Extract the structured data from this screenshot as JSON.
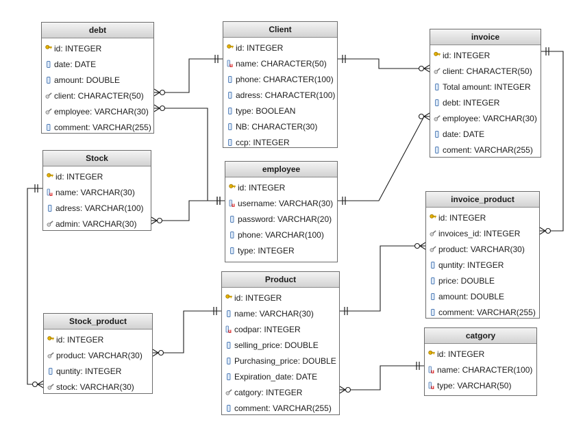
{
  "tables": [
    {
      "name": "debt",
      "fields": [
        {
          "text": "id: INTEGER",
          "icon": "key-icon"
        },
        {
          "text": "date: DATE",
          "icon": "column-icon"
        },
        {
          "text": "amount: DOUBLE",
          "icon": "column-icon"
        },
        {
          "text": "client: CHARACTER(50)",
          "icon": "foreign-key-icon"
        },
        {
          "text": "employee: VARCHAR(30)",
          "icon": "foreign-key-icon"
        },
        {
          "text": "comment: VARCHAR(255)",
          "icon": "column-icon"
        }
      ]
    },
    {
      "name": "Client",
      "fields": [
        {
          "text": "id: INTEGER",
          "icon": "key-icon"
        },
        {
          "text": "name: CHARACTER(50)",
          "icon": "unique-icon"
        },
        {
          "text": "phone: CHARACTER(100)",
          "icon": "column-icon"
        },
        {
          "text": "adress: CHARACTER(100)",
          "icon": "column-icon"
        },
        {
          "text": "type: BOOLEAN",
          "icon": "column-icon"
        },
        {
          "text": "NB: CHARACTER(30)",
          "icon": "column-icon"
        },
        {
          "text": "ccp: INTEGER",
          "icon": "column-icon"
        }
      ]
    },
    {
      "name": "invoice",
      "fields": [
        {
          "text": "id: INTEGER",
          "icon": "key-icon"
        },
        {
          "text": "client: CHARACTER(50)",
          "icon": "foreign-key-icon"
        },
        {
          "text": "Total amount: INTEGER",
          "icon": "column-icon"
        },
        {
          "text": "debt: INTEGER",
          "icon": "column-icon"
        },
        {
          "text": "employee: VARCHAR(30)",
          "icon": "foreign-key-icon"
        },
        {
          "text": "date: DATE",
          "icon": "column-icon"
        },
        {
          "text": "coment: VARCHAR(255)",
          "icon": "column-icon"
        }
      ]
    },
    {
      "name": "Stock",
      "fields": [
        {
          "text": "id: INTEGER",
          "icon": "key-icon"
        },
        {
          "text": "name: VARCHAR(30)",
          "icon": "unique-icon"
        },
        {
          "text": "adress: VARCHAR(100)",
          "icon": "column-icon"
        },
        {
          "text": "admin: VARCHAR(30)",
          "icon": "foreign-key-icon"
        }
      ]
    },
    {
      "name": "employee",
      "fields": [
        {
          "text": "id: INTEGER",
          "icon": "key-icon"
        },
        {
          "text": "username: VARCHAR(30)",
          "icon": "unique-icon"
        },
        {
          "text": "password: VARCHAR(20)",
          "icon": "column-icon"
        },
        {
          "text": "phone: VARCHAR(100)",
          "icon": "column-icon"
        },
        {
          "text": "type: INTEGER",
          "icon": "column-icon"
        }
      ]
    },
    {
      "name": "invoice_product",
      "fields": [
        {
          "text": "id: INTEGER",
          "icon": "key-icon"
        },
        {
          "text": "invoices_id: INTEGER",
          "icon": "foreign-key-icon"
        },
        {
          "text": "product: VARCHAR(30)",
          "icon": "foreign-key-icon"
        },
        {
          "text": "quntity: INTEGER",
          "icon": "column-icon"
        },
        {
          "text": "price: DOUBLE",
          "icon": "column-icon"
        },
        {
          "text": "amount: DOUBLE",
          "icon": "column-icon"
        },
        {
          "text": "comment: VARCHAR(255)",
          "icon": "column-icon"
        }
      ]
    },
    {
      "name": "Product",
      "fields": [
        {
          "text": "id: INTEGER",
          "icon": "key-icon"
        },
        {
          "text": "name: VARCHAR(30)",
          "icon": "column-icon"
        },
        {
          "text": "codpar: INTEGER",
          "icon": "unique-icon"
        },
        {
          "text": "selling_price: DOUBLE",
          "icon": "column-icon"
        },
        {
          "text": "Purchasing_price: DOUBLE",
          "icon": "column-icon"
        },
        {
          "text": "Expiration_date: DATE",
          "icon": "column-icon"
        },
        {
          "text": "catgory: INTEGER",
          "icon": "foreign-key-icon"
        },
        {
          "text": "comment: VARCHAR(255)",
          "icon": "column-icon"
        }
      ]
    },
    {
      "name": "Stock_product",
      "fields": [
        {
          "text": "id: INTEGER",
          "icon": "key-icon"
        },
        {
          "text": "product: VARCHAR(30)",
          "icon": "foreign-key-icon"
        },
        {
          "text": "quntity: INTEGER",
          "icon": "column-icon"
        },
        {
          "text": "stock: VARCHAR(30)",
          "icon": "foreign-key-icon"
        }
      ]
    },
    {
      "name": "catgory",
      "fields": [
        {
          "text": "id: INTEGER",
          "icon": "key-icon"
        },
        {
          "text": "name: CHARACTER(100)",
          "icon": "unique-icon"
        },
        {
          "text": "type: VARCHAR(50)",
          "icon": "unique-icon"
        }
      ]
    }
  ],
  "relationships": [
    {
      "name": "debt-client-to-client",
      "from": "debt.client",
      "to": "Client.id"
    },
    {
      "name": "debt-employee-to-employee",
      "from": "debt.employee",
      "to": "employee.id"
    },
    {
      "name": "invoice-client-to-client",
      "from": "invoice.client",
      "to": "Client.id"
    },
    {
      "name": "invoice-employee-to-employee",
      "from": "invoice.employee",
      "to": "employee.id"
    },
    {
      "name": "stock-admin-to-employee",
      "from": "Stock.admin",
      "to": "employee.id"
    },
    {
      "name": "invoice-product-invoice-to-invoice",
      "from": "invoice_product.invoices_id",
      "to": "invoice.id"
    },
    {
      "name": "invoice-product-product-to-product",
      "from": "invoice_product.product",
      "to": "Product.id"
    },
    {
      "name": "stock-product-product-to-product",
      "from": "Stock_product.product",
      "to": "Product.id"
    },
    {
      "name": "stock-product-stock-to-stock",
      "from": "Stock_product.stock",
      "to": "Stock.id"
    },
    {
      "name": "product-catgory-to-catgory",
      "from": "Product.catgory",
      "to": "catgory.id"
    }
  ]
}
